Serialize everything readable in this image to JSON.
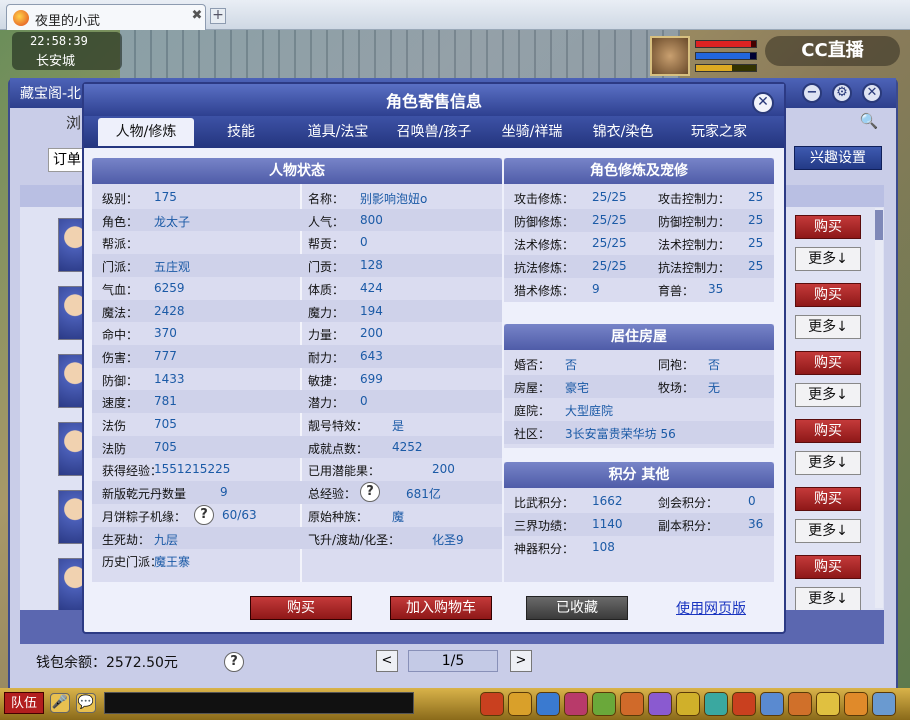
{
  "browser": {
    "tab_title": "夜里的小武",
    "tab_close": "✖",
    "new_tab": "+"
  },
  "game": {
    "time": "22:58:39",
    "location": "长安城",
    "watermark": "CC直播",
    "bottom": {
      "team_label": "队伍"
    }
  },
  "shop": {
    "title": "藏宝阁-北...",
    "tab_browse": "浏",
    "order_label": "订单",
    "interest_button": "兴趣设置",
    "buy_label": "购买",
    "more_label": "更多↓",
    "wallet": "钱包余额：2572.50元",
    "page_text": "1/5",
    "prev": "<",
    "next": ">",
    "help": "?"
  },
  "modal": {
    "title": "角色寄售信息",
    "close": "✕",
    "tabs": [
      "人物/修炼",
      "技能",
      "道具/法宝",
      "召唤兽/孩子",
      "坐骑/祥瑞",
      "锦衣/染色",
      "玩家之家"
    ],
    "status_title": "人物状态",
    "status_left": [
      {
        "label": "级别：",
        "value": "175"
      },
      {
        "label": "角色：",
        "value": "龙太子"
      },
      {
        "label": "帮派：",
        "value": ""
      },
      {
        "label": "门派：",
        "value": "五庄观"
      },
      {
        "label": "气血：",
        "value": "6259"
      },
      {
        "label": "魔法：",
        "value": "2428"
      },
      {
        "label": "命中：",
        "value": "370"
      },
      {
        "label": "伤害：",
        "value": "777"
      },
      {
        "label": "防御：",
        "value": "1433"
      },
      {
        "label": "速度：",
        "value": "781"
      },
      {
        "label": "法伤",
        "value": "705"
      },
      {
        "label": "法防",
        "value": "705"
      },
      {
        "label": "获得经验：",
        "value": "1551215225"
      },
      {
        "label": "新版乾元丹数量",
        "value": "9"
      },
      {
        "label": "月饼粽子机缘：",
        "value": "60/63",
        "help": "?"
      },
      {
        "label": "生死劫：",
        "value": "九层"
      },
      {
        "label": "历史门派：",
        "value": "魔王寨"
      }
    ],
    "status_right": [
      {
        "label": "名称：",
        "value": "别影响泡妞o"
      },
      {
        "label": "人气：",
        "value": "800"
      },
      {
        "label": "帮贡：",
        "value": "0"
      },
      {
        "label": "门贡：",
        "value": "128"
      },
      {
        "label": "体质：",
        "value": "424"
      },
      {
        "label": "魔力：",
        "value": "194"
      },
      {
        "label": "力量：",
        "value": "200"
      },
      {
        "label": "耐力：",
        "value": "643"
      },
      {
        "label": "敏捷：",
        "value": "699"
      },
      {
        "label": "潜力：",
        "value": "0"
      },
      {
        "label": "靓号特效：",
        "value": "是"
      },
      {
        "label": "成就点数：",
        "value": "4252"
      },
      {
        "label": "已用潜能果：",
        "value": "200"
      },
      {
        "label": "总经验：",
        "value": "681亿",
        "help": "?"
      },
      {
        "label": "原始种族：",
        "value": "魔"
      },
      {
        "label": "飞升/渡劫/化圣：",
        "value": "化圣9"
      }
    ],
    "cultivation_title": "角色修炼及宠修",
    "cultivation": [
      {
        "l1": "攻击修炼：",
        "v1": "25/25",
        "l2": "攻击控制力：",
        "v2": "25"
      },
      {
        "l1": "防御修炼：",
        "v1": "25/25",
        "l2": "防御控制力：",
        "v2": "25"
      },
      {
        "l1": "法术修炼：",
        "v1": "25/25",
        "l2": "法术控制力：",
        "v2": "25"
      },
      {
        "l1": "抗法修炼：",
        "v1": "25/25",
        "l2": "抗法控制力：",
        "v2": "25"
      },
      {
        "l1": "猎术修炼：",
        "v1": "9",
        "l2": "育兽：",
        "v2": "35"
      }
    ],
    "housing_title": "居住房屋",
    "housing": [
      {
        "l1": "婚否：",
        "v1": "否",
        "l2": "同袍：",
        "v2": "否"
      },
      {
        "l1": "房屋：",
        "v1": "豪宅",
        "l2": "牧场：",
        "v2": "无"
      },
      {
        "l1": "庭院：",
        "v1": "大型庭院",
        "l2": "",
        "v2": ""
      },
      {
        "l1": "社区：",
        "v1": "3长安富贵荣华坊 56",
        "l2": "",
        "v2": ""
      }
    ],
    "points_title": "积分 其他",
    "points": [
      {
        "l1": "比武积分：",
        "v1": "1662",
        "l2": "剑会积分：",
        "v2": "0"
      },
      {
        "l1": "三界功绩：",
        "v1": "1140",
        "l2": "副本积分：",
        "v2": "36"
      },
      {
        "l1": "神器积分：",
        "v1": "108",
        "l2": "",
        "v2": ""
      }
    ],
    "buttons": {
      "buy": "购买",
      "add_cart": "加入购物车",
      "favorited": "已收藏",
      "web_version": "使用网页版"
    }
  }
}
